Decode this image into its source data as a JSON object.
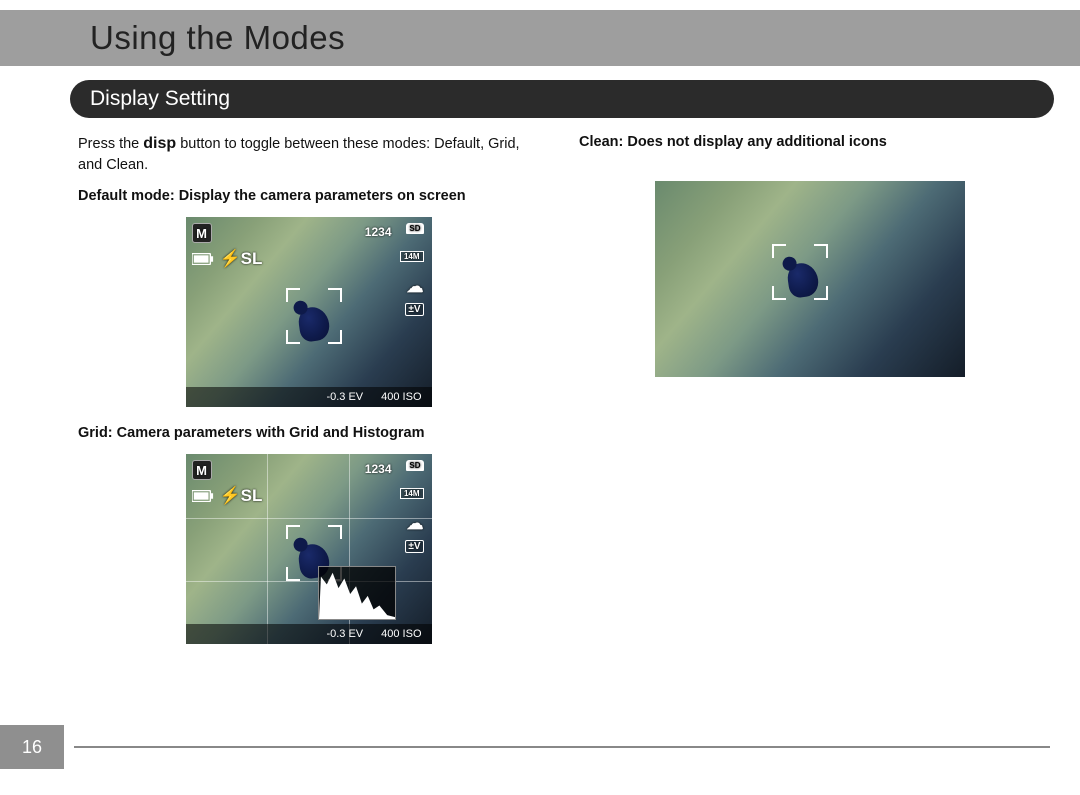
{
  "page": {
    "title": "Using the Modes",
    "section": "Display Setting",
    "page_number": "16"
  },
  "left": {
    "intro_a": "Press the ",
    "intro_button": "disp",
    "intro_b": " button to toggle between these modes: Default, Grid, and Clean.",
    "default_label": "Default mode: Display the camera parameters on screen",
    "grid_label": "Grid: Camera parameters with Grid and Histogram"
  },
  "right": {
    "clean_label": "Clean: Does not display any additional icons"
  },
  "camera_overlay": {
    "mode_badge": "M",
    "shots_remaining": "1234",
    "sd_label": "SD",
    "resolution": "14M",
    "wb_icon": "☁",
    "ev_icon": "±V",
    "ev_value": "-0.3 EV",
    "iso_value": "400 ISO",
    "flash_icon": "⚡SL"
  }
}
